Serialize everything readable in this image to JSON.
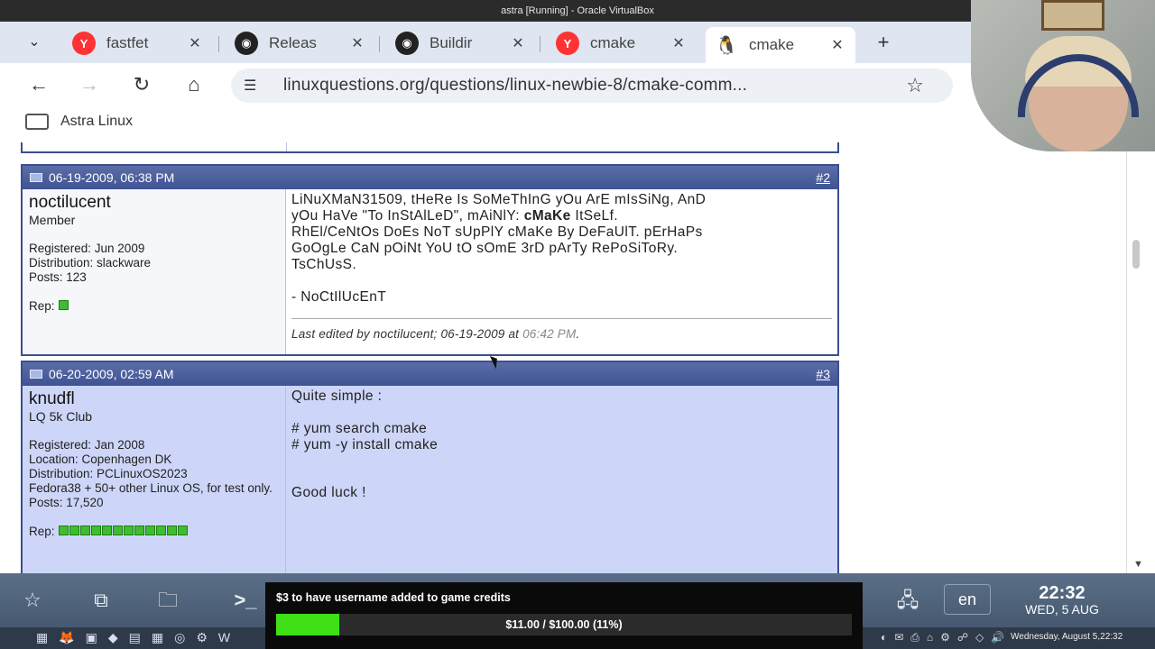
{
  "window_title": "astra [Running] - Oracle VirtualBox",
  "tabs": [
    {
      "label": "fastfet",
      "icon": "yandex-icon",
      "glyph": "Y"
    },
    {
      "label": "Releas",
      "icon": "github-icon",
      "glyph": "◉"
    },
    {
      "label": "Buildir",
      "icon": "github-icon",
      "glyph": "◉"
    },
    {
      "label": "cmake",
      "icon": "yandex-icon",
      "glyph": "Y"
    },
    {
      "label": "cmake",
      "icon": "tux-icon",
      "glyph": "🐧",
      "active": true
    }
  ],
  "toolbar": {
    "url": "linuxquestions.org/questions/linux-newbie-8/cmake-comm..."
  },
  "bookmarks": [
    {
      "label": "Astra Linux"
    }
  ],
  "posts": [
    {
      "date": "06-19-2009, 06:38 PM",
      "number": "#2",
      "username": "noctilucent",
      "user_title": "Member",
      "info": [
        "Registered: Jun 2009",
        "Distribution: slackware",
        "Posts: 123"
      ],
      "rep_label": "Rep:",
      "rep_pips": 1,
      "message_lines": [
        "LiNuXMaN31509, tHeRe Is SoMeThInG yOu ArE mIsSiNg, AnD",
        "yOu HaVe \"To InStAlLeD\", mAiNlY:",
        "cMaKe",
        "ItSeLf.",
        "RhEl/CeNtOs DoEs NoT sUpPlY cMaKe By DeFaUlT. pErHaPs",
        "GoOgLe CaN pOiNt YoU tO sOmE 3rD pArTy RePoSiToRy.",
        "TsChUsS.",
        "- NoCtIlUcEnT"
      ],
      "edited_prefix": "Last edited by noctilucent; 06-19-2009 at",
      "edited_time": "06:42 PM",
      "edited_suffix": "."
    },
    {
      "date": "06-20-2009, 02:59 AM",
      "number": "#3",
      "username": "knudfl",
      "user_title": "LQ 5k Club",
      "info": [
        "Registered: Jan 2008",
        "Location: Copenhagen DK",
        "Distribution: PCLinuxOS2023",
        "Fedora38 + 50+ other Linux OS, for test only.",
        "Posts: 17,520"
      ],
      "rep_label": "Rep:",
      "rep_pips": 12,
      "message_lines": [
        "Quite simple :",
        "# yum search cmake",
        "# yum -y install cmake",
        "Good luck !"
      ]
    }
  ],
  "taskbar": {
    "lang": "en",
    "time": "22:32",
    "date": "WED, 5 AUG",
    "system_date": "Wednesday, August  5,22:32"
  },
  "donation": {
    "title": "$3 to have username added to game credits",
    "progress_label": "$11.00 / $100.00 (11%)",
    "progress_fraction": 0.11,
    "fill_color": "#3fe016"
  }
}
